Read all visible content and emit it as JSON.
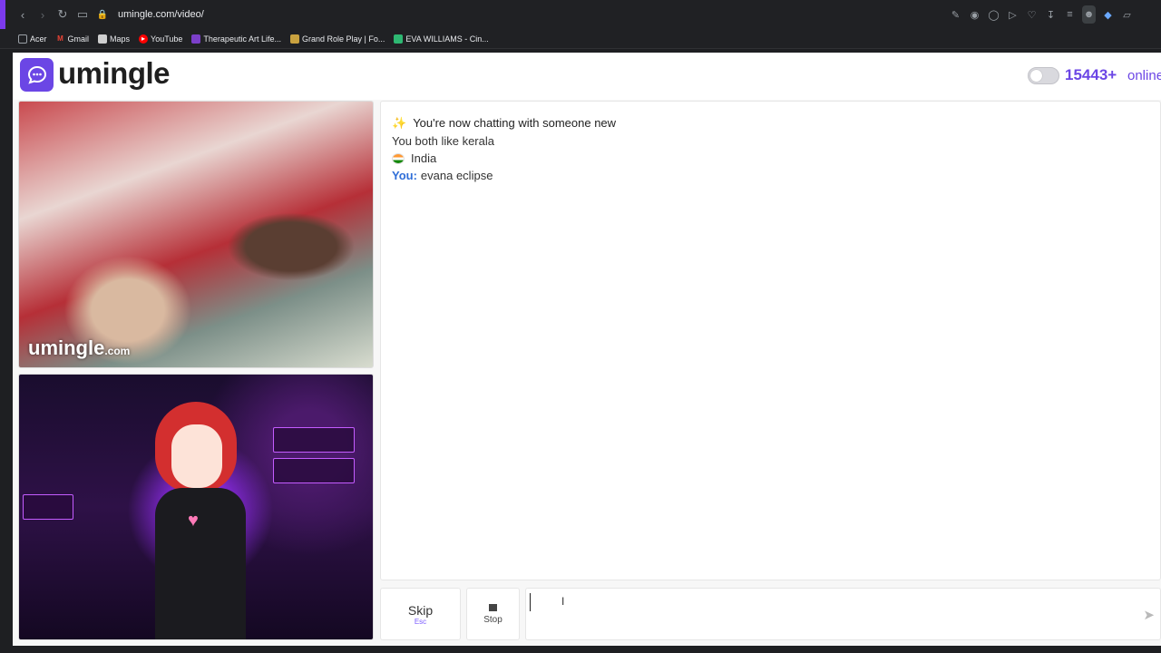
{
  "browser": {
    "url": "umingle.com/video/",
    "bookmarks": [
      {
        "label": "Acer",
        "color": "#9aa0a6",
        "icon": "folder-icon"
      },
      {
        "label": "Gmail",
        "color": "#ea4335",
        "icon": "gmail-icon"
      },
      {
        "label": "Maps",
        "color": "#cfcfcf",
        "icon": "page-icon"
      },
      {
        "label": "YouTube",
        "color": "#ff0000",
        "icon": "youtube-icon"
      },
      {
        "label": "Therapeutic Art Life...",
        "color": "#7b3fc9",
        "icon": "therapeutic-icon"
      },
      {
        "label": "Grand Role Play | Fo...",
        "color": "#c9a23f",
        "icon": "roleplay-icon"
      },
      {
        "label": "EVA WILLIAMS - Cin...",
        "color": "#2eb872",
        "icon": "eva-icon"
      }
    ]
  },
  "header": {
    "logo_text": "umingle",
    "online_count": "15443+",
    "online_label": "online"
  },
  "videos": {
    "stranger_watermark": "umingle",
    "stranger_watermark_sub": ".com"
  },
  "chat": {
    "title": "You're now chatting with someone new",
    "common_interest": "You both like kerala",
    "country": "India",
    "you_label": "You:",
    "you_message": "evana eclipse"
  },
  "controls": {
    "skip_label": "Skip",
    "skip_key": "Esc",
    "stop_label": "Stop",
    "message_value": ""
  },
  "colors": {
    "brand": "#6b46e5",
    "you_label": "#2f6ed8"
  }
}
